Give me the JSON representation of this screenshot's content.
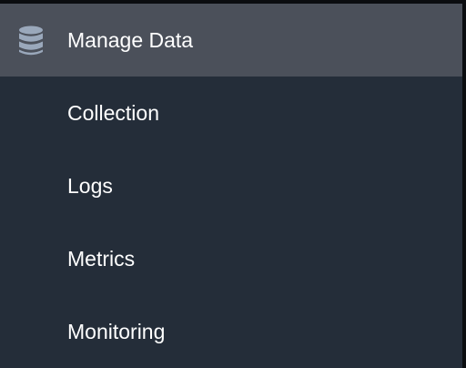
{
  "menu": {
    "header": {
      "label": "Manage Data",
      "icon": "database-icon"
    },
    "items": [
      {
        "label": "Collection"
      },
      {
        "label": "Logs"
      },
      {
        "label": "Metrics"
      },
      {
        "label": "Monitoring"
      }
    ]
  },
  "colors": {
    "header_bg": "#4b505a",
    "menu_bg": "#242d39",
    "icon": "#9aa8bb",
    "text": "#ffffff"
  }
}
